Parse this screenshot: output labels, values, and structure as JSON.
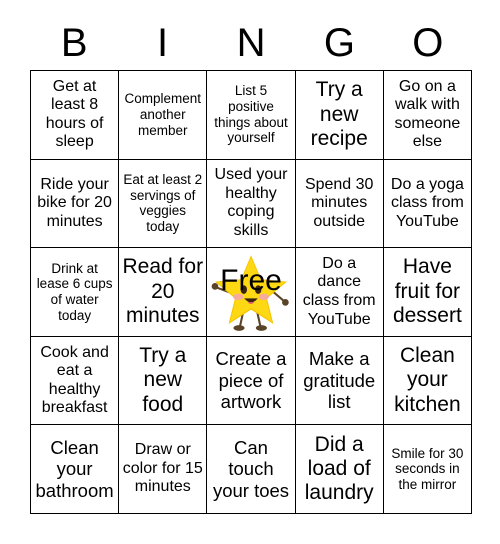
{
  "header": {
    "letters": [
      "B",
      "I",
      "N",
      "G",
      "O"
    ]
  },
  "free_space": {
    "label": "Free",
    "icon": "smiling-star-icon",
    "colors": {
      "star_fill": "#ffd814",
      "star_shade": "#f5c400",
      "cheek": "#f6a3b4",
      "eye": "#3b2314",
      "mouth": "#3b2314",
      "tongue": "#e4596a",
      "limb": "#5a4427"
    }
  },
  "grid": {
    "rows": 5,
    "columns": 5,
    "border_color": "#000000",
    "background": "#ffffff",
    "cells": [
      [
        {
          "text": "Get at least 8 hours of sleep",
          "size": "md"
        },
        {
          "text": "Complement another member",
          "size": "sm"
        },
        {
          "text": "List 5 positive things about yourself",
          "size": "sm"
        },
        {
          "text": "Try a new recipe",
          "size": "xl"
        },
        {
          "text": "Go on a walk with someone else",
          "size": "md"
        }
      ],
      [
        {
          "text": "Ride your bike for 20 minutes",
          "size": "md"
        },
        {
          "text": "Eat at least 2 servings of veggies today",
          "size": "sm"
        },
        {
          "text": "Used your healthy coping skills",
          "size": "md"
        },
        {
          "text": "Spend 30 minutes outside",
          "size": "md"
        },
        {
          "text": "Do a yoga class from YouTube",
          "size": "md"
        }
      ],
      [
        {
          "text": "Drink at lease 6 cups of water today",
          "size": "sm"
        },
        {
          "text": "Read for 20 minutes",
          "size": "xl"
        },
        {
          "text": "Free",
          "size": "free",
          "free": true
        },
        {
          "text": "Do a dance class from YouTube",
          "size": "md"
        },
        {
          "text": "Have fruit for dessert",
          "size": "xl"
        }
      ],
      [
        {
          "text": "Cook and eat a healthy breakfast",
          "size": "md"
        },
        {
          "text": "Try a new food",
          "size": "xl"
        },
        {
          "text": "Create a piece of artwork",
          "size": "lg"
        },
        {
          "text": "Make a gratitude list",
          "size": "lg"
        },
        {
          "text": "Clean your kitchen",
          "size": "xl"
        }
      ],
      [
        {
          "text": "Clean your bathroom",
          "size": "lg"
        },
        {
          "text": "Draw or color for 15 minutes",
          "size": "md"
        },
        {
          "text": "Can touch your toes",
          "size": "lg"
        },
        {
          "text": "Did a load of laundry",
          "size": "xl"
        },
        {
          "text": "Smile for 30 seconds in the mirror",
          "size": "sm"
        }
      ]
    ]
  }
}
